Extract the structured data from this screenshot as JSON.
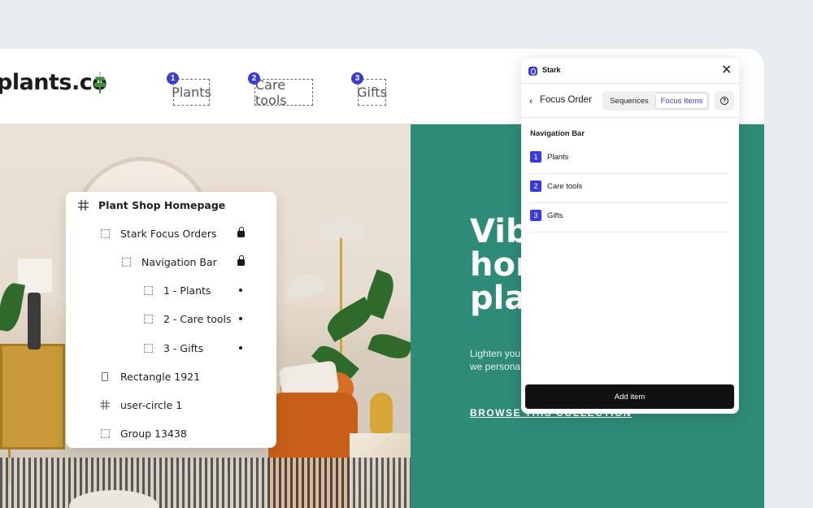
{
  "site": {
    "logo": "plants.co",
    "nav": [
      {
        "number": "1",
        "label": "Plants"
      },
      {
        "number": "2",
        "label": "Care tools"
      },
      {
        "number": "3",
        "label": "Gifts"
      }
    ],
    "hero": {
      "title_lines": [
        "Vib",
        "hon",
        "pla"
      ],
      "subtitle_lines": [
        "Lighten you",
        "we persona"
      ],
      "cta": "BROWSE THIS COLLECTION"
    },
    "colors": {
      "hero_green": "#2e8b77",
      "accent": "#3a3ad6"
    }
  },
  "layers": {
    "items": [
      {
        "label": "Plant Shop Homepage",
        "icon": "frame-icon"
      },
      {
        "label": "Stark Focus Orders",
        "icon": "group-icon",
        "marker": "lock-icon"
      },
      {
        "label": "Navigation Bar",
        "icon": "group-icon",
        "marker": "lock-icon"
      },
      {
        "label": "1 - Plants",
        "icon": "group-icon",
        "marker": "dot-icon"
      },
      {
        "label": "2 - Care tools",
        "icon": "group-icon",
        "marker": "dot-icon"
      },
      {
        "label": "3 - Gifts",
        "icon": "group-icon",
        "marker": "dot-icon"
      },
      {
        "label": "Rectangle 1921",
        "icon": "rectangle-icon"
      },
      {
        "label": "user-circle 1",
        "icon": "frame-icon"
      },
      {
        "label": "Group 13438",
        "icon": "group-icon"
      }
    ]
  },
  "stark": {
    "app_name": "Stark",
    "close_icon": "close-icon",
    "header": "Focus Order",
    "tabs": [
      "Sequences",
      "Focus Items"
    ],
    "active_tab": "Focus Items",
    "help": "?",
    "section": "Navigation Bar",
    "items": [
      {
        "number": "1",
        "label": "Plants"
      },
      {
        "number": "2",
        "label": "Care tools"
      },
      {
        "number": "3",
        "label": "Gifts"
      }
    ],
    "add_button": "Add item"
  }
}
